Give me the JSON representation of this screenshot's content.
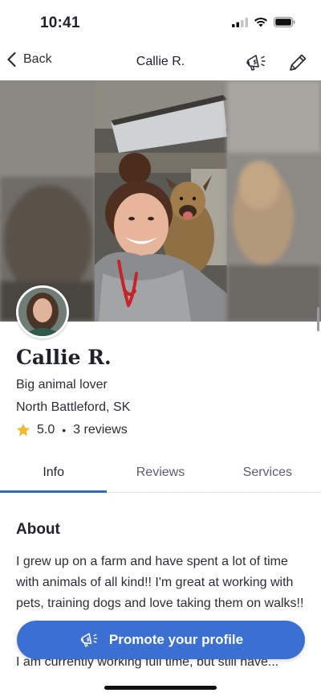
{
  "status_bar": {
    "time": "10:41"
  },
  "nav": {
    "back_label": "Back",
    "title": "Callie R."
  },
  "profile": {
    "name": "Callie R.",
    "tagline": "Big animal lover",
    "location": "North Battleford, SK",
    "rating": "5.0",
    "reviews": "3 reviews"
  },
  "tabs": [
    {
      "label": "Info",
      "active": true
    },
    {
      "label": "Reviews",
      "active": false
    },
    {
      "label": "Services",
      "active": false
    }
  ],
  "about": {
    "title": "About",
    "paragraph1": "I grew up on a farm and have spent a lot of time with animals of all kind!! I'm great at working with pets, training dogs and love taking them on walks!!",
    "paragraph2": "I am currently working full time, but still have..."
  },
  "promote": {
    "label": "Promote your profile"
  },
  "colors": {
    "accent": "#3b6fd2",
    "tab_indicator": "#3566c6",
    "star": "#f5b82e",
    "text": "#1f2329"
  },
  "icons": {
    "back": "chevron-left-icon",
    "promote": "megaphone-dollar-icon",
    "edit": "pencil-icon",
    "rating": "star-icon"
  }
}
